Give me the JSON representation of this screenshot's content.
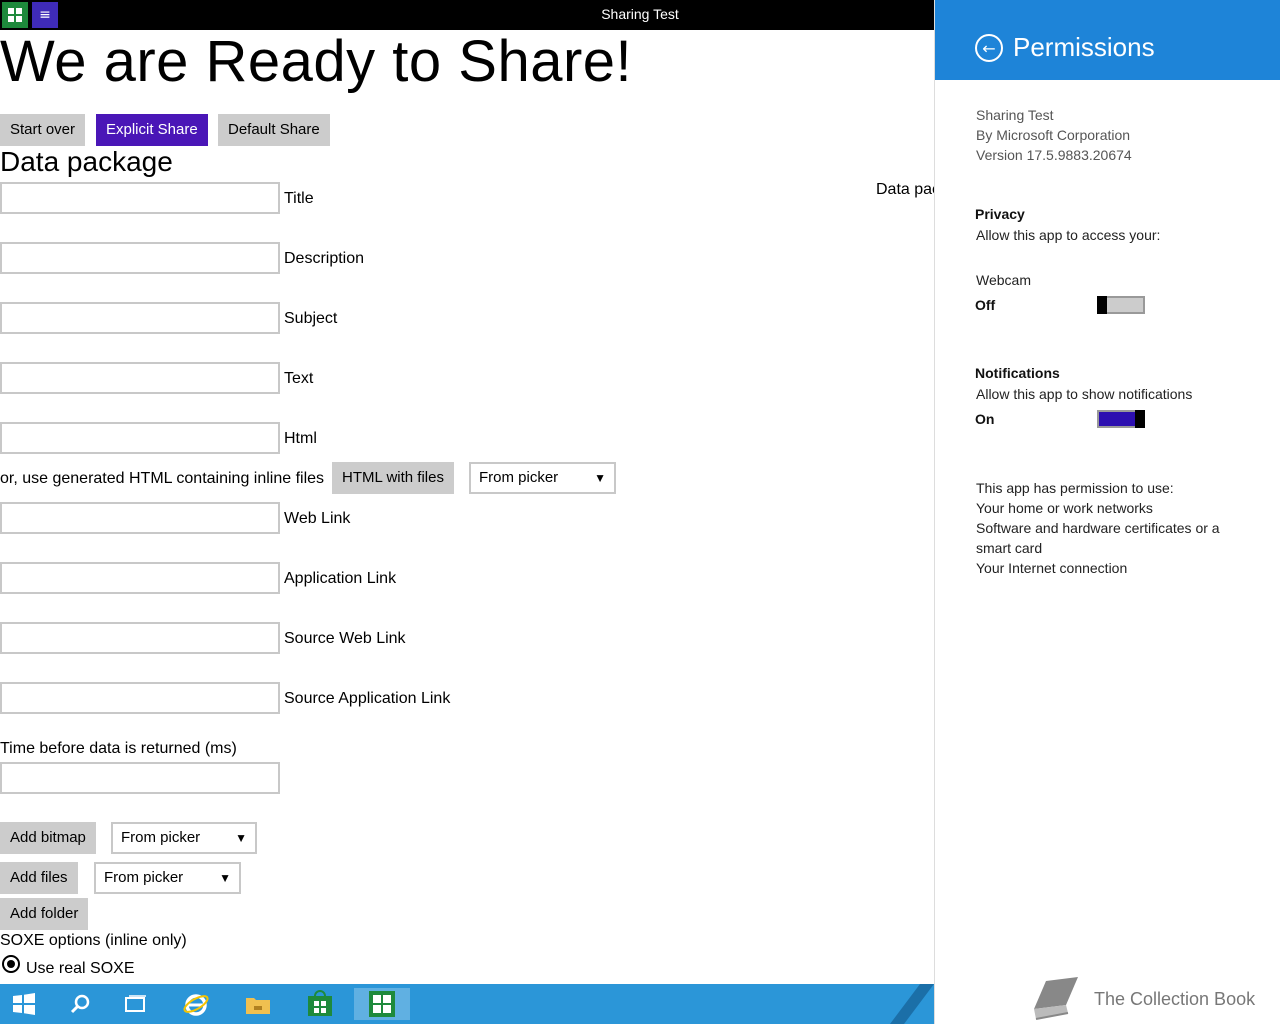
{
  "window": {
    "title": "Sharing Test"
  },
  "heading": "We are Ready to Share!",
  "top_buttons": {
    "start_over": "Start over",
    "explicit_share": "Explicit Share",
    "default_share": "Default Share"
  },
  "section_title": "Data package",
  "truncated_right_label": "Data pac",
  "fields": [
    {
      "label": "Title",
      "value": ""
    },
    {
      "label": "Description",
      "value": ""
    },
    {
      "label": "Subject",
      "value": ""
    },
    {
      "label": "Text",
      "value": ""
    },
    {
      "label": "Html",
      "value": ""
    },
    {
      "label": "Web Link",
      "value": ""
    },
    {
      "label": "Application Link",
      "value": ""
    },
    {
      "label": "Source Web Link",
      "value": ""
    },
    {
      "label": "Source Application Link",
      "value": ""
    }
  ],
  "html_row": {
    "prefix": "or, use generated HTML containing inline files",
    "button": "HTML with files",
    "select": "From picker"
  },
  "time_field": {
    "label": "Time before data is returned (ms)",
    "value": ""
  },
  "bitmap": {
    "button": "Add bitmap",
    "select": "From picker"
  },
  "files": {
    "button": "Add files",
    "select": "From picker"
  },
  "folder": {
    "button": "Add folder"
  },
  "soxe": {
    "label": "SOXE options (inline only)",
    "option_real": "Use real SOXE"
  },
  "panel": {
    "title": "Permissions",
    "app_name": "Sharing Test",
    "publisher": "By Microsoft Corporation",
    "version": "Version 17.5.9883.20674",
    "privacy_title": "Privacy",
    "privacy_desc": "Allow this app to access your:",
    "webcam_label": "Webcam",
    "webcam_state": "Off",
    "notifications_title": "Notifications",
    "notifications_desc": "Allow this app to show notifications",
    "notifications_state": "On",
    "permission_heading": "This app has permission to use:",
    "permissions": [
      "Your home or work networks",
      "Software and hardware certificates or a",
      "smart card",
      "Your Internet connection"
    ]
  },
  "watermark": "The Collection Book",
  "colors": {
    "accent": "#4a16b7",
    "panel_header": "#1e84d8",
    "taskbar": "#2b96d8",
    "app_icon": "#1e8a3c"
  }
}
